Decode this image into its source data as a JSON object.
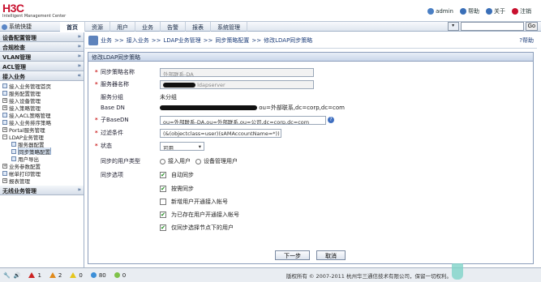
{
  "header": {
    "logo": "H3C",
    "subtitle": "Intelligent Management Center",
    "links": [
      {
        "label": "admin",
        "icon": "user-icon",
        "color": "#4a7fc4"
      },
      {
        "label": "帮助",
        "icon": "help-icon",
        "color": "#3a6fb8"
      },
      {
        "label": "关于",
        "icon": "info-icon",
        "color": "#3a6fb8"
      },
      {
        "label": "注销",
        "icon": "logout-icon",
        "color": "#c8102e"
      }
    ]
  },
  "nav": {
    "config_label": "系统快捷",
    "items": [
      "首页",
      "资源",
      "用户",
      "业务",
      "告警",
      "报表",
      "系统管理"
    ],
    "active_index": 0,
    "search_placeholder": "",
    "go_label": "Go",
    "shortcut_label": "其他"
  },
  "sidebar": {
    "sections": [
      {
        "title": "设备配置管理",
        "items": []
      },
      {
        "title": "合规检查",
        "items": []
      },
      {
        "title": "VLAN管理",
        "items": []
      },
      {
        "title": "ACL管理",
        "items": []
      },
      {
        "title": "接入业务",
        "items": [
          {
            "label": "接入业务管理首页",
            "kind": "page"
          },
          {
            "label": "服务配置管理",
            "kind": "page"
          },
          {
            "label": "接入设备管理",
            "kind": "node"
          },
          {
            "label": "接入策略管理",
            "kind": "node"
          },
          {
            "label": "接入ACL策略管理",
            "kind": "page"
          },
          {
            "label": "接入业务排序策略",
            "kind": "page"
          },
          {
            "label": "Portal服务管理",
            "kind": "node"
          },
          {
            "label": "LDAP业务管理",
            "kind": "node-open"
          },
          {
            "label": "服务器配置",
            "kind": "child"
          },
          {
            "label": "同步策略配置",
            "kind": "child-sel"
          },
          {
            "label": "用户导出",
            "kind": "child"
          },
          {
            "label": "业务参数配置",
            "kind": "node"
          },
          {
            "label": "帐单打印管理",
            "kind": "page"
          },
          {
            "label": "报表管理",
            "kind": "node"
          }
        ]
      },
      {
        "title": "无线业务管理",
        "items": []
      }
    ]
  },
  "breadcrumb": {
    "parts": [
      "业务",
      "接入业务",
      "LDAP业务管理",
      "同步策略配置",
      "修改LDAP同步策略"
    ],
    "help": "帮助"
  },
  "form": {
    "panel_title": "修改LDAP同步策略",
    "fields": {
      "policy_name": {
        "label": "同步策略名称",
        "value": "外部联系-DA"
      },
      "server_name": {
        "label": "服务器名称",
        "value": "ldapserver"
      },
      "server_type": {
        "label": "服务分组",
        "value": "未分组"
      },
      "base_dn": {
        "label": "Base DN",
        "value": "ou=外部联系,dc=corp,dc=com"
      },
      "sub_base_dn": {
        "label": "子BaseDN",
        "value": "ou=外部联系-DA,ou=外部联系,ou=公司,dc=corp,dc=com"
      },
      "filter": {
        "label": "过滤条件",
        "value": "(&(objectclass=user)(sAMAccountName=*))"
      },
      "status": {
        "label": "状态",
        "value": "可用"
      },
      "sync_object": {
        "label": "同步的用户类型",
        "options": [
          "接入用户",
          "设备管理用户"
        ]
      },
      "sync_options": {
        "label": "同步选项",
        "items": [
          {
            "label": "自动同步",
            "checked": true
          },
          {
            "label": "按需同步",
            "checked": true
          },
          {
            "label": "新增用户开通接入帐号",
            "checked": false
          },
          {
            "label": "为已存在用户开通接入帐号",
            "checked": true
          },
          {
            "label": "仅同步选择节点下的用户",
            "checked": true
          }
        ]
      }
    },
    "buttons": {
      "next": "下一步",
      "cancel": "取消"
    }
  },
  "status_bar": {
    "alarms": [
      {
        "count": "1",
        "color": "#cc2222",
        "icon": "critical-alarm-icon"
      },
      {
        "count": "2",
        "color": "#e08a1c",
        "icon": "major-alarm-icon"
      },
      {
        "count": "0",
        "color": "#e6c61c",
        "icon": "minor-alarm-icon"
      },
      {
        "count": "80",
        "color": "#3c8fd8",
        "icon": "warning-alarm-icon"
      },
      {
        "count": "0",
        "color": "#7fc24a",
        "icon": "info-alarm-icon"
      }
    ],
    "copyright": "版权所有 © 2007-2011 杭州华三通信技术有限公司，保留一切权利。"
  }
}
